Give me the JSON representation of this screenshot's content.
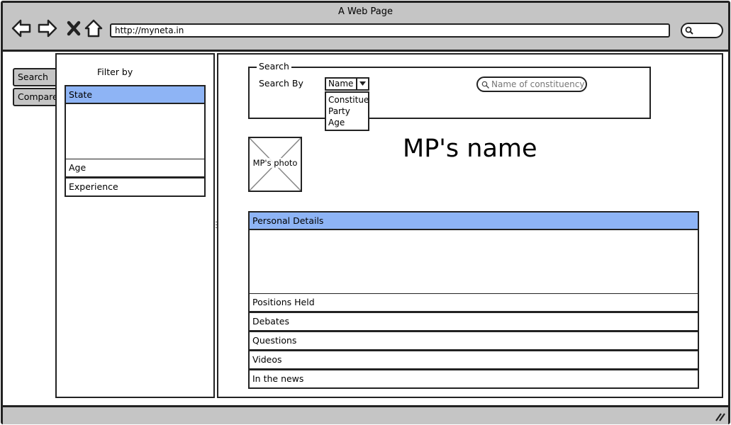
{
  "window": {
    "title": "A Web Page",
    "url": "http://myneta.in"
  },
  "side_tabs": [
    {
      "label": "Search"
    },
    {
      "label": "Compare"
    }
  ],
  "filter": {
    "title": "Filter by",
    "items": [
      {
        "label": "State",
        "active": true
      },
      {
        "label": "Age",
        "active": false
      },
      {
        "label": "Experience",
        "active": false
      }
    ]
  },
  "search": {
    "legend": "Search",
    "search_by_label": "Search By",
    "combo_value": "Name",
    "combo_options": [
      "Constitue",
      "Party",
      "Age"
    ],
    "constituency_placeholder": "Name of constituency"
  },
  "profile": {
    "photo_label": "MP's photo",
    "name": "MP's name"
  },
  "details": {
    "items": [
      {
        "label": "Personal Details",
        "active": true
      },
      {
        "label": "Positions Held",
        "active": false
      },
      {
        "label": "Debates",
        "active": false
      },
      {
        "label": "Questions",
        "active": false
      },
      {
        "label": "Videos",
        "active": false
      },
      {
        "label": "In the news",
        "active": false
      }
    ]
  },
  "colors": {
    "chrome": "#c5c5c5",
    "accent": "#8eb4f5"
  }
}
